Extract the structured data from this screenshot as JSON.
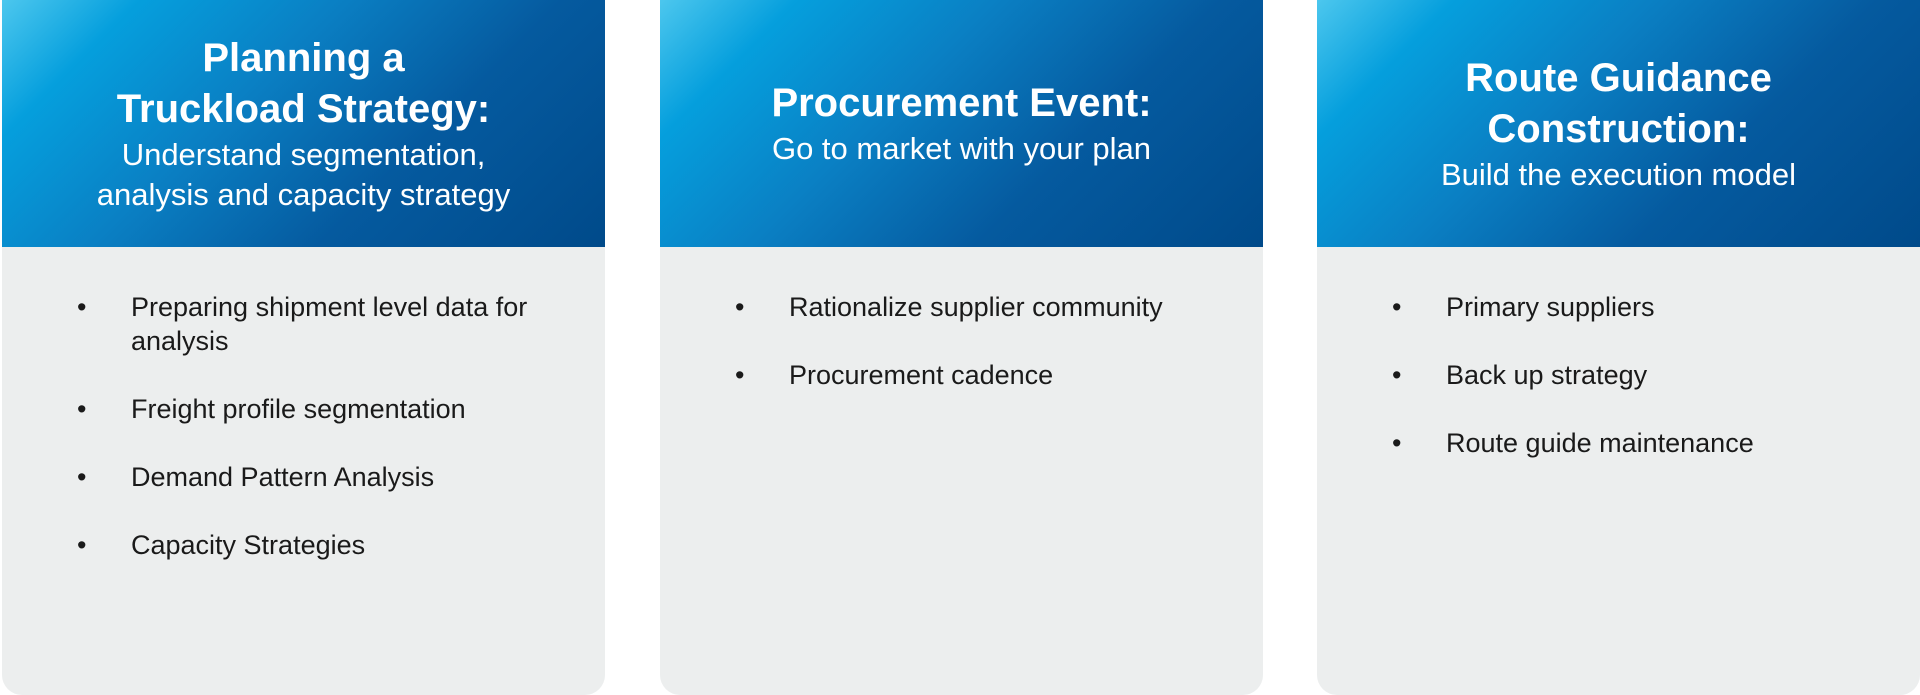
{
  "cards": [
    {
      "title_lines": [
        "Planning a",
        "Truckload Strategy:"
      ],
      "subtitle_lines": [
        "Understand segmentation,",
        "analysis and capacity strategy"
      ],
      "items": [
        "Preparing shipment level data for analysis",
        "Freight profile segmentation",
        "Demand Pattern Analysis",
        "Capacity Strategies"
      ]
    },
    {
      "title_lines": [
        "Procurement Event:"
      ],
      "subtitle_lines": [
        "Go to market with your plan"
      ],
      "items": [
        "Rationalize supplier community",
        "Procurement cadence"
      ]
    },
    {
      "title_lines": [
        "Route Guidance",
        "Construction:"
      ],
      "subtitle_lines": [
        "Build the execution model"
      ],
      "items": [
        "Primary suppliers",
        "Back up strategy",
        "Route guide maintenance"
      ]
    }
  ],
  "bullet_char": "•",
  "colors": {
    "header_gradient_start": "#4cc7ee",
    "header_gradient_end": "#004a8a",
    "card_body": "#eceeee",
    "body_text": "#1a1a1a"
  }
}
